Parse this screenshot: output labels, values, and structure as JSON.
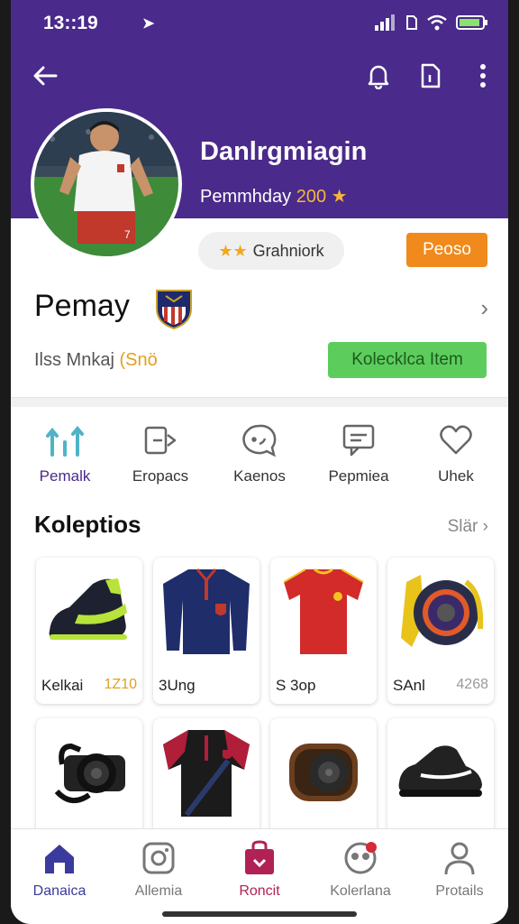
{
  "status": {
    "time": "13::19",
    "nav_arrow": "➤"
  },
  "header": {
    "back_icon": "back-arrow-icon",
    "actions": [
      "bell-icon",
      "document-icon",
      "more-vert-icon"
    ]
  },
  "profile": {
    "name": "Danlrgmiagin",
    "subtitle_text": "Pemmhday",
    "subtitle_num": "200",
    "subtitle_star": "★",
    "jersey_number": "7"
  },
  "chip": {
    "stars": "★★",
    "label": "Grahniork"
  },
  "action_button": {
    "label": "Peoso"
  },
  "team": {
    "name": "Pemay",
    "sub_text": "Ilss Mnkaj",
    "sub_hl": "(Snö",
    "chevron": "›",
    "follow_button": "Kolecklca Item"
  },
  "quick_actions": [
    {
      "label": "Pemalk",
      "icon": "stats-icon"
    },
    {
      "label": "Eropacs",
      "icon": "card-swap-icon"
    },
    {
      "label": "Kaenos",
      "icon": "chat-icon"
    },
    {
      "label": "Pepmiea",
      "icon": "message-icon"
    },
    {
      "label": "Uhek",
      "icon": "heart-chat-icon"
    }
  ],
  "collections": {
    "title": "Koleptios",
    "see_all": "Slär ›",
    "items": [
      {
        "label": "Kelkai",
        "price": "1Z10",
        "icon": "sneaker-icon"
      },
      {
        "label": "3Ung",
        "price": "",
        "icon": "jersey-icon"
      },
      {
        "label": "S 3op",
        "price": "",
        "icon": "shirt-icon"
      },
      {
        "label": "SAnl",
        "price": "4268",
        "icon": "speaker-icon"
      },
      {
        "label": "",
        "price": "",
        "icon": "camera-icon"
      },
      {
        "label": "",
        "price": "",
        "icon": "polo-icon"
      },
      {
        "label": "",
        "price": "",
        "icon": "round-speaker-icon"
      },
      {
        "label": "",
        "price": "",
        "icon": "shoe-icon"
      }
    ]
  },
  "nav": [
    {
      "label": "Danaica",
      "icon": "home-icon",
      "color": "#3b3a9e"
    },
    {
      "label": "Allemia",
      "icon": "instagram-icon",
      "color": "#777777"
    },
    {
      "label": "Roncit",
      "icon": "bag-icon",
      "color": "#b02255"
    },
    {
      "label": "Kolerlana",
      "icon": "group-icon",
      "color": "#777777"
    },
    {
      "label": "Protails",
      "icon": "user-icon",
      "color": "#777777"
    }
  ],
  "colors": {
    "header": "#4a2a8a",
    "accent_orange": "#f08a1c",
    "accent_green": "#5ccd5c",
    "gold": "#f4b640"
  }
}
